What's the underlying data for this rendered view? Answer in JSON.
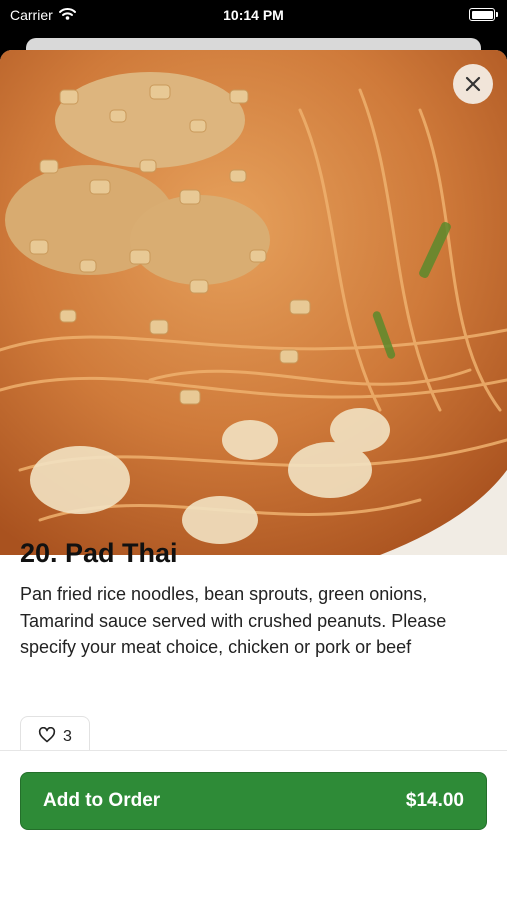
{
  "status_bar": {
    "carrier": "Carrier",
    "time": "10:14 PM",
    "icons": [
      "wifi-icon",
      "battery-icon"
    ]
  },
  "hero_image": {
    "subject": "pad-thai-photo"
  },
  "item": {
    "title": "20. Pad Thai",
    "description": "Pan fried rice noodles, bean sprouts, green onions, Tamarind sauce served with crushed peanuts. Please specify your meat choice, chicken or pork or beef",
    "likes": "3"
  },
  "actions": {
    "close_icon": "close-icon",
    "add_label": "Add to Order",
    "price": "$14.00"
  },
  "colors": {
    "accent": "#2e8b37",
    "background": "#ffffff",
    "text": "#111111"
  }
}
